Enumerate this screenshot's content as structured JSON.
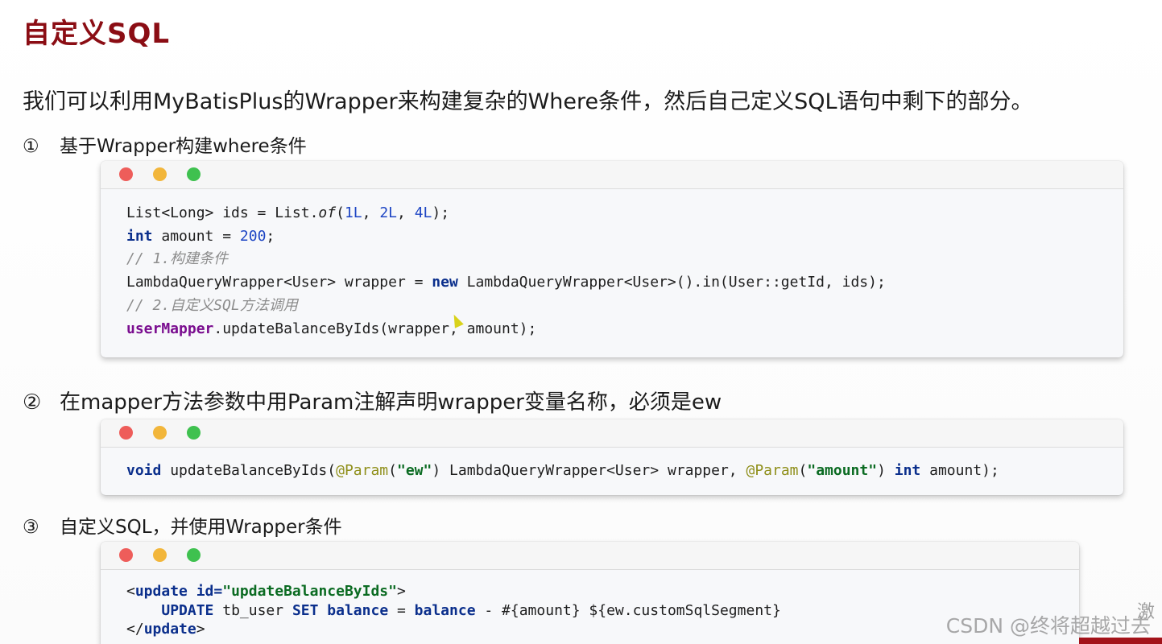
{
  "title": "自定义SQL",
  "intro": "我们可以利用MyBatisPlus的Wrapper来构建复杂的Where条件，然后自己定义SQL语句中剩下的部分。",
  "steps": [
    {
      "num": "①",
      "text": "基于Wrapper构建where条件"
    },
    {
      "num": "②",
      "text": "在mapper方法参数中用Param注解声明wrapper变量名称，必须是ew"
    },
    {
      "num": "③",
      "text": "自定义SQL，并使用Wrapper条件"
    }
  ],
  "code1": {
    "l1": {
      "a": "List<Long> ids = List.",
      "of": "of",
      "b": "(",
      "n1": "1L",
      "c1": ", ",
      "n2": "2L",
      "c2": ", ",
      "n3": "4L",
      "d": ");"
    },
    "l2": {
      "kw": "int",
      "a": " amount = ",
      "n": "200",
      "b": ";"
    },
    "l3": "// 1.构建条件",
    "l4": {
      "a": "LambdaQueryWrapper<User> wrapper = ",
      "kw": "new",
      "b": " LambdaQueryWrapper<User>().in(User::getId, ids);"
    },
    "l5": "// 2.自定义SQL方法调用",
    "l6": {
      "obj": "userMapper",
      "a": ".updateBalanceByIds(wrapper, amount);"
    }
  },
  "code2": {
    "kw1": "void",
    "a": " updateBalanceByIds(",
    "anno1": "@Param",
    "p1": "(",
    "s1": "\"ew\"",
    "b": ") LambdaQueryWrapper<User> wrapper, ",
    "anno2": "@Param",
    "p2": "(",
    "s2": "\"amount\"",
    "c": ") ",
    "kw2": "int",
    "d": " amount);"
  },
  "code3": {
    "l1": {
      "lt": "<",
      "tag": "update",
      "sp": " ",
      "attr": "id=",
      "val": "\"updateBalanceByIds\"",
      "gt": ">"
    },
    "l2": {
      "indent": "    ",
      "k1": "UPDATE",
      "a": " tb_user ",
      "k2": "SET",
      "sp1": " ",
      "k3": "balance",
      "b": " = ",
      "k4": "balance",
      "c": " - #{amount} ${ew.customSqlSegment}"
    },
    "l3": {
      "lt": "</",
      "tag": "update",
      "gt": ">"
    }
  },
  "watermark": "CSDN @终将超越过去",
  "side_text": "激"
}
